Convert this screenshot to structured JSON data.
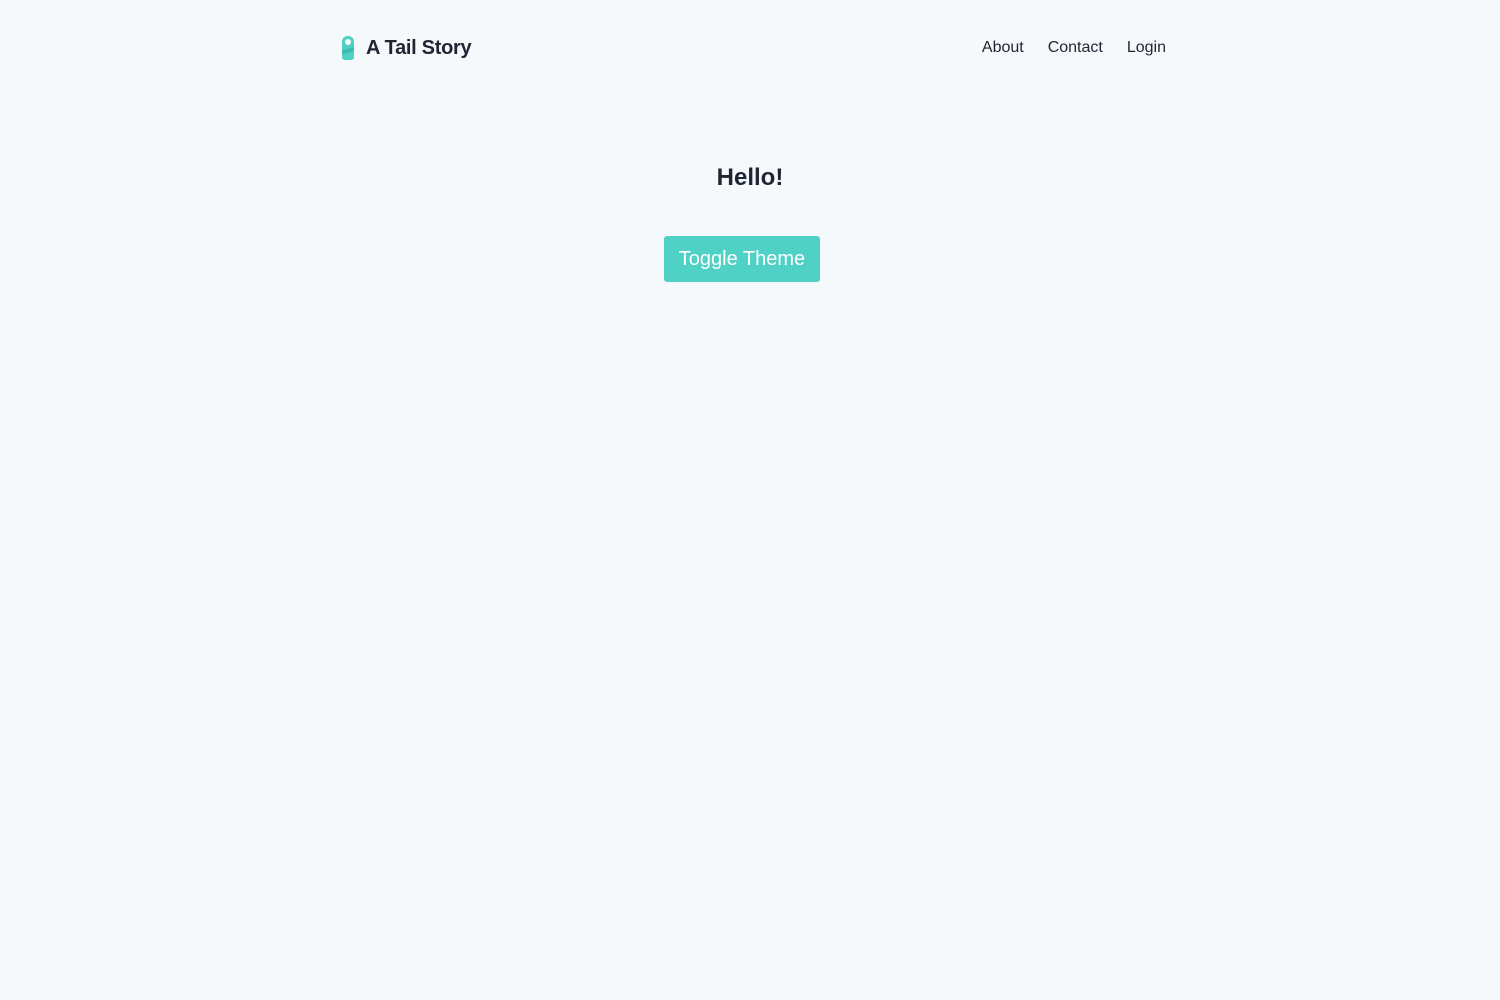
{
  "header": {
    "brand_name": "A Tail Story",
    "logo_icon": "pet-tag-icon",
    "nav": [
      {
        "label": "About"
      },
      {
        "label": "Contact"
      },
      {
        "label": "Login"
      }
    ]
  },
  "main": {
    "heading": "Hello!",
    "toggle_label": "Toggle Theme"
  },
  "colors": {
    "background": "#f6f9fb",
    "accent": "#4fd1c5",
    "text": "#1f2533"
  }
}
